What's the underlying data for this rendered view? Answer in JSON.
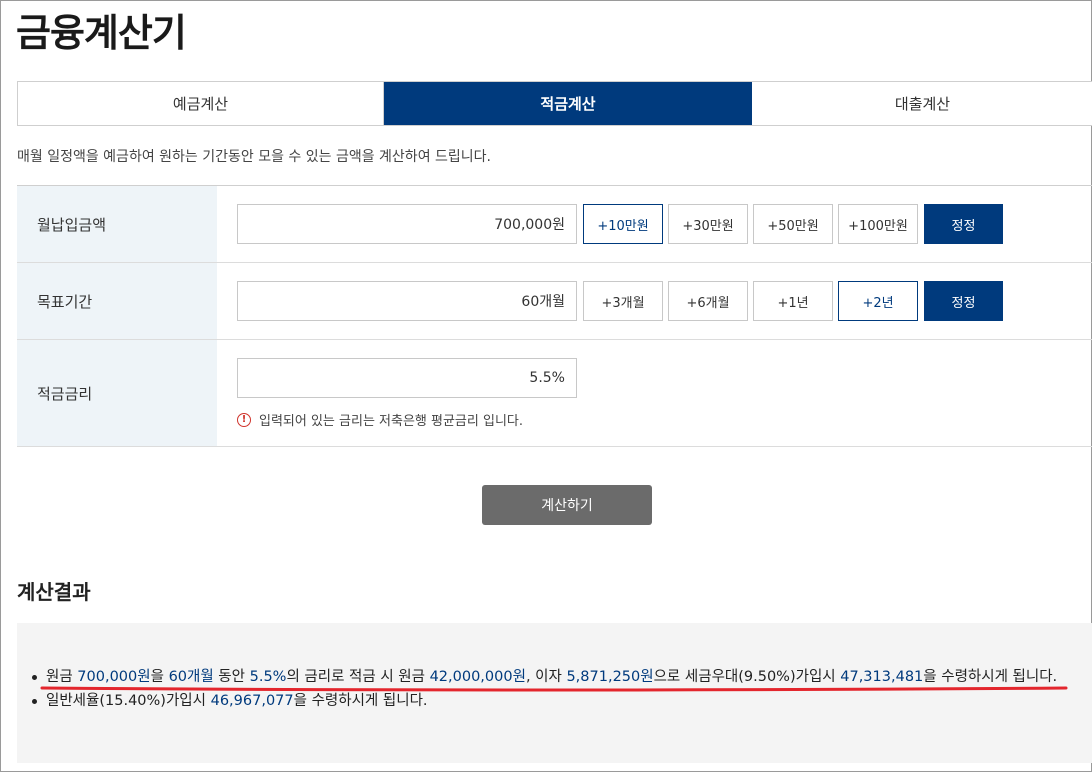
{
  "page": {
    "title": "금융계산기"
  },
  "tabs": [
    {
      "label": "예금계산",
      "active": false
    },
    {
      "label": "적금계산",
      "active": true
    },
    {
      "label": "대출계산",
      "active": false
    }
  ],
  "description": "매월 일정액을 예금하여 원하는 기간동안 모을 수 있는 금액을 계산하여 드립니다.",
  "form": {
    "monthly": {
      "label": "월납입금액",
      "value": "700,000원",
      "buttons": [
        "+10만원",
        "+30만원",
        "+50만원",
        "+100만원"
      ],
      "reset_label": "정정"
    },
    "period": {
      "label": "목표기간",
      "value": "60개월",
      "buttons": [
        "+3개월",
        "+6개월",
        "+1년",
        "+2년"
      ],
      "reset_label": "정정"
    },
    "rate": {
      "label": "적금금리",
      "value": "5.5%",
      "notice": "입력되어 있는 금리는 저축은행 평균금리 입니다."
    }
  },
  "calculate_label": "계산하기",
  "result": {
    "title": "계산결과",
    "line1": {
      "p1": "원금 ",
      "principal": "700,000원",
      "p2": "을 ",
      "period": "60개월",
      "p3": " 동안 ",
      "rate": "5.5%",
      "p4": "의 금리로 적금 시 원금 ",
      "total_principal": "42,000,000원",
      "p5": ", 이자 ",
      "interest": "5,871,250원",
      "p6": "으로 세금우대(9.50%)가입시 ",
      "preferential_amount": "47,313,481",
      "p7": "을 수령하시게 됩니다."
    },
    "line2": {
      "p1": "일반세율(15.40%)가입시 ",
      "general_amount": "46,967,077",
      "p2": "을 수령하시게 됩니다."
    }
  },
  "colors": {
    "primary": "#003a7d",
    "label_bg": "#eef4f8",
    "result_bg": "#f4f4f4",
    "underline": "#e3262d",
    "button_gray": "#6b6b6b"
  }
}
